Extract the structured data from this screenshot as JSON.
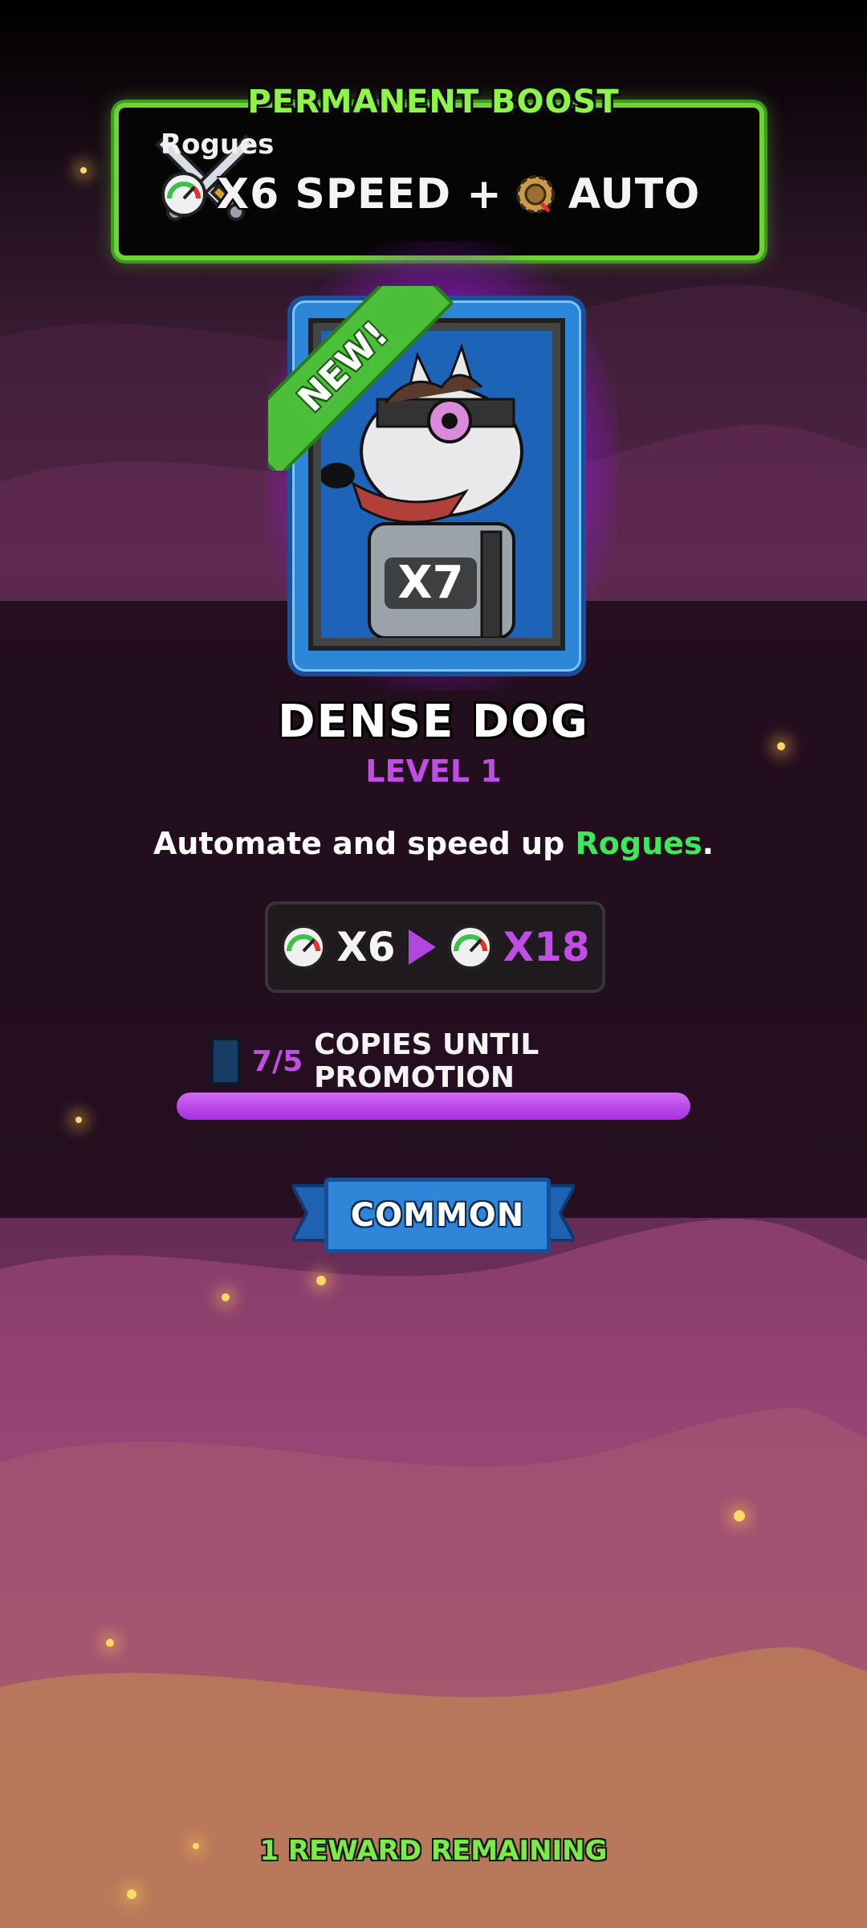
{
  "boost": {
    "title": "PERMANENT BOOST",
    "category": "Rogues",
    "speed_text": "X6 SPEED +",
    "auto_text": "AUTO"
  },
  "card": {
    "badge": "NEW!",
    "multiplier": "X7",
    "name": "DENSE DOG",
    "level": "LEVEL 1"
  },
  "description": {
    "prefix": "Automate and speed up ",
    "highlight": "Rogues",
    "suffix": "."
  },
  "upgrade": {
    "from": "X6",
    "to": "X18"
  },
  "copies": {
    "count": "7/5",
    "label": "COPIES UNTIL PROMOTION",
    "progress_fraction": 1.0
  },
  "rarity": "COMMON",
  "footer": "1 REWARD REMAINING",
  "colors": {
    "accent_green": "#8df548",
    "accent_purple": "#c04ee6",
    "rarity_blue": "#2f86d8"
  }
}
